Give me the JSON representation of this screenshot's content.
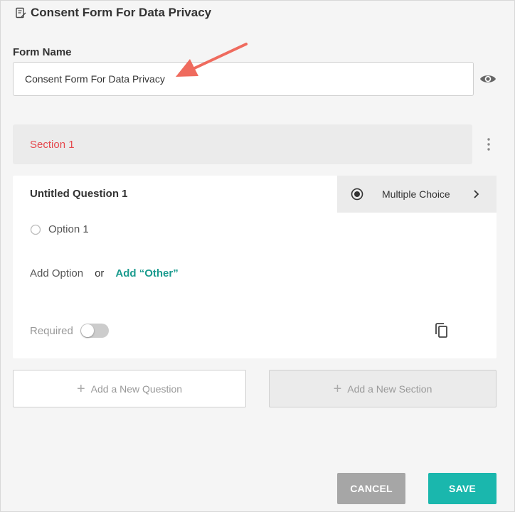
{
  "header": {
    "title": "Consent Form For Data Privacy",
    "icon": "edit-document-icon"
  },
  "form": {
    "name_label": "Form Name",
    "name_value": "Consent Form For Data Privacy"
  },
  "section": {
    "title": "Section 1",
    "title_color": "#e5484d"
  },
  "question": {
    "title": "Untitled Question 1",
    "type_label": "Multiple Choice",
    "options": [
      "Option 1"
    ],
    "add_option_label": "Add Option",
    "or_label": "or",
    "add_other_label": "Add “Other”",
    "required_label": "Required",
    "required": false
  },
  "actions": {
    "add_question_label": "Add a New Question",
    "add_section_label": "Add a New Section",
    "cancel_label": "CANCEL",
    "save_label": "SAVE"
  },
  "colors": {
    "accent": "#1ab7ad",
    "link": "#1a9b8e",
    "annotation_arrow": "#ef6b5e"
  }
}
